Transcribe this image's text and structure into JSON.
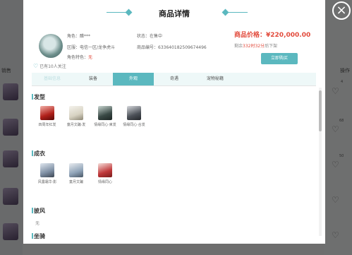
{
  "background": {
    "left_label": "销售",
    "right_label": "操作",
    "right_counts": [
      "4",
      "68",
      "50"
    ]
  },
  "modal": {
    "title": "商品详情",
    "close_glyph": "×",
    "role": {
      "name_label": "角色：",
      "name_value": "醋***",
      "server_label": "区服：",
      "server_value": "电信一区/龙争虎斗",
      "feature_label": "角色特色：",
      "feature_value": "无",
      "status_label": "状态：",
      "status_value": "在售中",
      "id_label": "商品编号：",
      "id_value": "63364018250967449​6"
    },
    "follow_text": "已有10人关注",
    "price_label": "商品价格：",
    "price_value": "¥220,000.00",
    "remain_prefix": "剩余",
    "remain_value": "332时32分",
    "remain_suffix": "后下架",
    "buy_label": "立即购买",
    "tabs": [
      "基础信息",
      "装备",
      "外观",
      "奇遇",
      "宠物秘籍"
    ],
    "active_tab": "外观",
    "sections": {
      "hair": {
        "title": "发型",
        "items": [
          "四周年红发",
          "童月文蹁·发",
          "情缘同心·束发",
          "情缘同心·合发"
        ]
      },
      "outfit": {
        "title": "成衣",
        "items": [
          "风露霜华·影",
          "童月文蹁",
          "情缘同心"
        ]
      },
      "cloak": {
        "title": "披风",
        "value": "无"
      },
      "mount": {
        "title": "坐骑"
      }
    }
  },
  "colors": {
    "accent": "#5bb8bf",
    "price": "#e24a3b"
  }
}
